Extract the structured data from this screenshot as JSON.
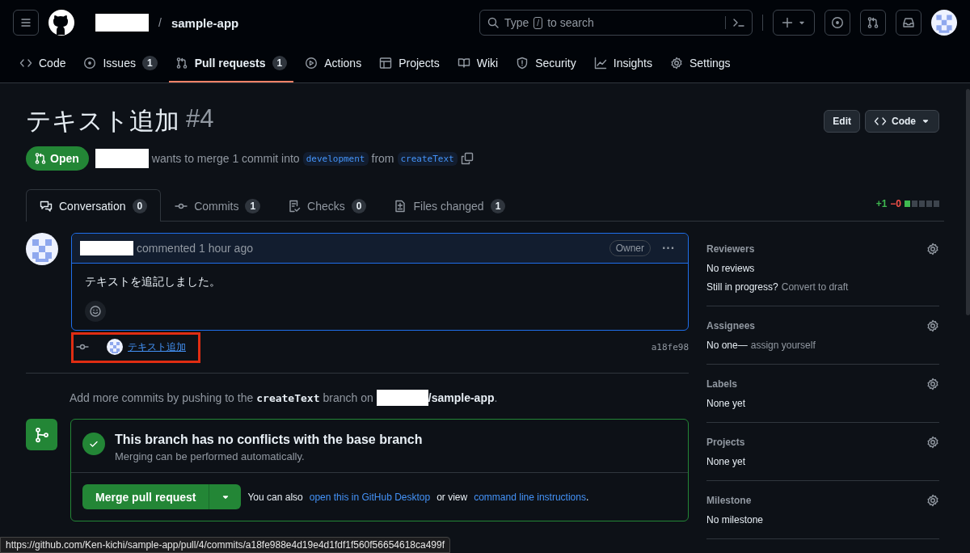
{
  "header": {
    "separator": "/",
    "repo": "sample-app",
    "search": {
      "placeholder_prefix": "Type",
      "key": "/",
      "placeholder_suffix": "to search"
    }
  },
  "repo_nav": [
    {
      "label": "Code",
      "selected": false
    },
    {
      "label": "Issues",
      "count": "1",
      "selected": false
    },
    {
      "label": "Pull requests",
      "count": "1",
      "selected": true
    },
    {
      "label": "Actions",
      "selected": false
    },
    {
      "label": "Projects",
      "selected": false
    },
    {
      "label": "Wiki",
      "selected": false
    },
    {
      "label": "Security",
      "selected": false
    },
    {
      "label": "Insights",
      "selected": false
    },
    {
      "label": "Settings",
      "selected": false
    }
  ],
  "pr": {
    "title": "テキスト追加",
    "number": "#4",
    "state": "Open",
    "summary": "wants to merge 1 commit into",
    "base": "development",
    "from": "from",
    "head": "createText",
    "buttons": [
      "Edit",
      "Code"
    ]
  },
  "tabs": [
    {
      "label": "Conversation",
      "count": "0",
      "selected": true
    },
    {
      "label": "Commits",
      "count": "1",
      "selected": false
    },
    {
      "label": "Checks",
      "count": "0",
      "selected": false
    },
    {
      "label": "Files changed",
      "count": "1",
      "selected": false
    }
  ],
  "diffstat": {
    "added": "+1",
    "removed": "−0"
  },
  "comment": {
    "action": "commented 1 hour ago",
    "role": "Owner",
    "menu": "···",
    "body": "テキストを追記しました。"
  },
  "commit": {
    "message": "テキスト追加",
    "sha": "a18fe98",
    "highlighted": true
  },
  "push_hint": {
    "before": "Add more commits by pushing to the",
    "branch": "createText",
    "middle": "branch on",
    "repo": "/sample-app",
    "end": "."
  },
  "merge": {
    "title": "This branch has no conflicts with the base branch",
    "subtitle": "Merging can be performed automatically.",
    "button": "Merge pull request",
    "also": "You can also",
    "link1": "open this in GitHub Desktop",
    "or": "or view",
    "link2": "command line instructions",
    "end": "."
  },
  "sidebar": [
    {
      "title": "Reviewers",
      "lines": [
        [
          {
            "text": "No reviews",
            "link": false
          }
        ],
        [
          {
            "text": "Still in progress?",
            "link": false
          },
          {
            "text": "Convert to draft",
            "link": true
          }
        ]
      ]
    },
    {
      "title": "Assignees",
      "lines": [
        [
          {
            "text": "No one—",
            "link": false
          },
          {
            "text": "assign yourself",
            "link": true
          }
        ]
      ]
    },
    {
      "title": "Labels",
      "lines": [
        [
          {
            "text": "None yet",
            "link": false
          }
        ]
      ]
    },
    {
      "title": "Projects",
      "lines": [
        [
          {
            "text": "None yet",
            "link": false
          }
        ]
      ]
    },
    {
      "title": "Milestone",
      "lines": [
        [
          {
            "text": "No milestone",
            "link": false
          }
        ]
      ]
    }
  ],
  "status_url": "https://github.com/Ken-kichi/sample-app/pull/4/commits/a18fe988e4d19e4d1fdf1f560f56654618ca499f"
}
